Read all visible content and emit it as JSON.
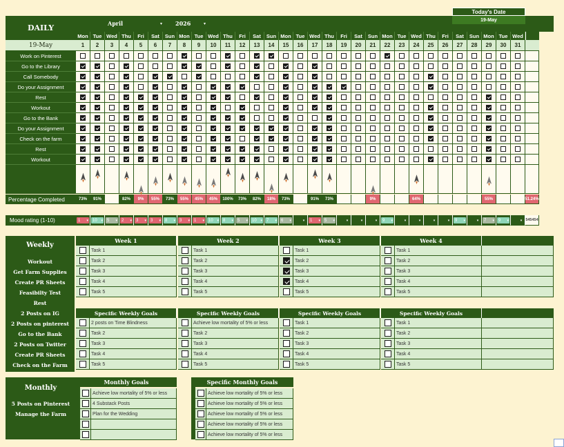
{
  "header": {
    "month": "April",
    "year": "2026",
    "todays_date_label": "Today's Date",
    "todays_date_value": "19-May"
  },
  "daily": {
    "title": "DAILY",
    "date_cell": "19-May",
    "weekdays": [
      "Mon",
      "Tue",
      "Wed",
      "Thu",
      "Fri",
      "Sat",
      "Sun",
      "Mon",
      "Tue",
      "Wed",
      "Thu",
      "Fri",
      "Sat",
      "Sun",
      "Mon",
      "Tue",
      "Wed",
      "Thu",
      "Fri",
      "Sat",
      "Sun",
      "Mon",
      "Tue",
      "Wed",
      "Thu",
      "Fri",
      "Sat",
      "Sun",
      "Mon",
      "Tue",
      "Wed"
    ],
    "days": [
      "1",
      "2",
      "3",
      "4",
      "5",
      "6",
      "7",
      "8",
      "9",
      "10",
      "11",
      "12",
      "13",
      "14",
      "15",
      "16",
      "17",
      "18",
      "19",
      "20",
      "21",
      "22",
      "23",
      "24",
      "25",
      "26",
      "27",
      "28",
      "29",
      "30",
      "31"
    ],
    "tasks": [
      {
        "label": "Work on Pinterest",
        "checks": "0000000100101100000001000000000"
      },
      {
        "label": "Go to  the Library",
        "checks": "1101000110101010100000000000000"
      },
      {
        "label": "Call Somebody",
        "checks": "1101011010001010100000001000000"
      },
      {
        "label": "Do your Assignment",
        "checks": "1101010101110010111000001000000"
      },
      {
        "label": "Rest",
        "checks": "1101110101101010110000000000100"
      },
      {
        "label": "Workout",
        "checks": "1101110101010010110000001000100"
      },
      {
        "label": "Go to  the Bank",
        "checks": "1101110101110010010000001000100"
      },
      {
        "label": "Do your Assignment",
        "checks": "1101110101111110110000001000100"
      },
      {
        "label": "Check on the farm",
        "checks": "1101110101101110110000001000100"
      },
      {
        "label": "Rest",
        "checks": "1101110101111010110000000000100"
      },
      {
        "label": "Workout",
        "checks": "1101110101111010110000001000100"
      }
    ],
    "progress_label": "Percentage Completed",
    "percentages": [
      "73%",
      "91%",
      "",
      "82%",
      "9%",
      "55%",
      "73%",
      "55%",
      "45%",
      "45%",
      "100%",
      "73%",
      "82%",
      "18%",
      "73%",
      "",
      "91%",
      "73%",
      "",
      "",
      "9%",
      "",
      "",
      "64%",
      "",
      "",
      "",
      "",
      "55%",
      "",
      "",
      "51.24%"
    ],
    "percentage_colors": [
      "dark",
      "dark",
      "",
      "dark",
      "red",
      "red",
      "dark",
      "red",
      "red",
      "red",
      "dark",
      "dark",
      "dark",
      "red",
      "dark",
      "",
      "dark",
      "dark",
      "",
      "",
      "red",
      "",
      "",
      "red",
      "",
      "",
      "",
      "",
      "red",
      "",
      "",
      "red"
    ],
    "mood_label": "Mood rating (1-10)",
    "moods": [
      "1",
      "10",
      "5",
      "2",
      "3",
      "3",
      "8",
      "3",
      "1",
      "10",
      "8",
      "5",
      "10",
      "7",
      "6",
      "",
      "1",
      "5",
      "",
      "",
      "",
      "9",
      "",
      "",
      "",
      "",
      "9",
      "",
      "7",
      "9",
      "",
      ""
    ],
    "mood_colors": [
      "red",
      "mint",
      "gray",
      "red",
      "red",
      "red",
      "mint",
      "red",
      "red",
      "mint",
      "mint",
      "gray",
      "mint",
      "mint",
      "gray",
      "",
      "red",
      "gray",
      "",
      "",
      "",
      "mint",
      "",
      "",
      "",
      "",
      "mint",
      "",
      "gray",
      "mint",
      "",
      ""
    ],
    "mood_total": "545454"
  },
  "weekly": {
    "title": "Weekly",
    "sidebar": [
      "Workout",
      "Get Farm Supplies",
      "Create PR Sheets",
      "Feasibilty Test",
      "Rest",
      "2 Posts on IG",
      "2 Posts on pinterest",
      "Go to the Bank",
      "2 Posts on Twitter",
      "Create PR Sheets",
      "Check on the Farm"
    ],
    "weeks": [
      {
        "name": "Week 1",
        "tasks": [
          {
            "label": "Task 1",
            "checked": false
          },
          {
            "label": "Task 2",
            "checked": false
          },
          {
            "label": "Task 3",
            "checked": false
          },
          {
            "label": "Task 4",
            "checked": false
          },
          {
            "label": "Task 5",
            "checked": false
          }
        ]
      },
      {
        "name": "Week 2",
        "tasks": [
          {
            "label": "Task 1",
            "checked": false
          },
          {
            "label": "Task 2",
            "checked": false
          },
          {
            "label": "Task 3",
            "checked": false
          },
          {
            "label": "Task 4",
            "checked": false
          },
          {
            "label": "Task 5",
            "checked": false
          }
        ]
      },
      {
        "name": "Week 3",
        "tasks": [
          {
            "label": "Task 1",
            "checked": false
          },
          {
            "label": "Task 2",
            "checked": true
          },
          {
            "label": "Task 3",
            "checked": true
          },
          {
            "label": "Task 4",
            "checked": true
          },
          {
            "label": "Task 5",
            "checked": false
          }
        ]
      },
      {
        "name": "Week 4",
        "tasks": [
          {
            "label": "Task 1",
            "checked": false
          },
          {
            "label": "Task 2",
            "checked": false
          },
          {
            "label": "Task 3",
            "checked": false
          },
          {
            "label": "Task 4",
            "checked": false
          },
          {
            "label": "Task 5",
            "checked": false
          }
        ]
      }
    ],
    "goals_header": "Specific Weekly Goals",
    "goals": [
      [
        {
          "label": "2 posts on Time Blindness",
          "checked": false
        },
        {
          "label": "Task 2",
          "checked": false
        },
        {
          "label": "Task 3",
          "checked": false
        },
        {
          "label": "Task 4",
          "checked": false
        },
        {
          "label": "Task 5",
          "checked": false
        }
      ],
      [
        {
          "label": "Achieve low mortality of 5% or less",
          "checked": false
        },
        {
          "label": "Task 2",
          "checked": false
        },
        {
          "label": "Task 3",
          "checked": false
        },
        {
          "label": "Task 4",
          "checked": false
        },
        {
          "label": "Task 5",
          "checked": false
        }
      ],
      [
        {
          "label": "Task 1",
          "checked": false
        },
        {
          "label": "Task 2",
          "checked": false
        },
        {
          "label": "Task 3",
          "checked": false
        },
        {
          "label": "Task 4",
          "checked": false
        },
        {
          "label": "Task 5",
          "checked": false
        }
      ],
      [
        {
          "label": "Task 1",
          "checked": false
        },
        {
          "label": "Task 2",
          "checked": false
        },
        {
          "label": "Task 3",
          "checked": false
        },
        {
          "label": "Task 4",
          "checked": false
        },
        {
          "label": "Task 5",
          "checked": false
        }
      ]
    ]
  },
  "monthly": {
    "title": "Monthly",
    "sidebar": [
      "5 Posts on Pinterest",
      "Manage the Farm"
    ],
    "goals_header": "Monthly Goals",
    "goals": [
      "Achieve low mortality of 5% or less",
      "4 Substack Posts",
      "Plan for the Wedding",
      "",
      ""
    ],
    "specific_header": "Specific Monthly Goals",
    "specific": [
      "Achieve low mortality of 5% or less",
      "Achieve low mortality of 5% or less",
      "Achieve low mortality of 5% or less",
      "Achieve low mortality of 5% or less",
      "Achieve low mortality of 5% or less"
    ]
  },
  "colors": {
    "dark_green": "#2c5a17",
    "light_green": "#d9ecd0",
    "background": "#fdf3d1",
    "red": "#e06670",
    "mint": "#8fd6b8"
  }
}
